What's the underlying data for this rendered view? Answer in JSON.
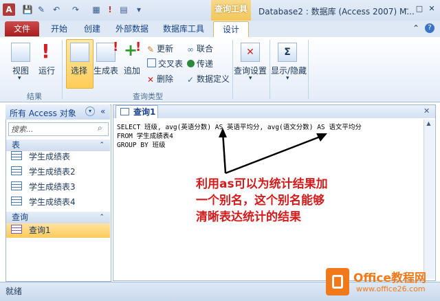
{
  "window": {
    "app_icon_letter": "A",
    "context_tab": "查询工具",
    "title": "Database2 : 数据库 (Access 2007) M...",
    "controls": [
      "–",
      "□",
      "✕"
    ]
  },
  "tabs": {
    "file": "文件",
    "home": "开始",
    "create": "创建",
    "external": "外部数据",
    "dbtools": "数据库工具",
    "design": "设计"
  },
  "ribbon": {
    "results": {
      "view": "视图",
      "run": "运行",
      "group": "结果"
    },
    "query_type": {
      "select": "选择",
      "make_table": "生成表",
      "append": "追加",
      "update": "更新",
      "crosstab": "交叉表",
      "delete": "删除",
      "union": "联合",
      "pass_through": "传递",
      "data_definition": "数据定义",
      "group": "查询类型"
    },
    "query_setup": "查询设置",
    "show_hide": "显示/隐藏"
  },
  "nav": {
    "title": "所有 Access 对象",
    "search_placeholder": "搜索...",
    "sections": [
      {
        "title": "表",
        "items": [
          "学生成绩表",
          "学生成绩表2",
          "学生成绩表3",
          "学生成绩表4"
        ]
      },
      {
        "title": "查询",
        "items": [
          "查询1"
        ]
      }
    ]
  },
  "document": {
    "tab_label": "查询1",
    "sql_lines": [
      "SELECT 班级, avg(英语分数) AS 英语平均分, avg(语文分数) AS 语文平均分",
      "FROM 学生成绩表4",
      "GROUP BY 班级"
    ],
    "annotation": [
      "利用as可以为统计结果加",
      "一个别名，这个别名能够",
      "清晰表达统计的结果"
    ]
  },
  "status": {
    "text": "就绪"
  },
  "watermark": {
    "brand": "Office教程网",
    "url": "www.office26.com"
  },
  "colors": {
    "file_tab": "#b82828",
    "context_tab": "#f2c75c",
    "annotation": "#d41b1b",
    "watermark_orange": "#f07a1a"
  }
}
